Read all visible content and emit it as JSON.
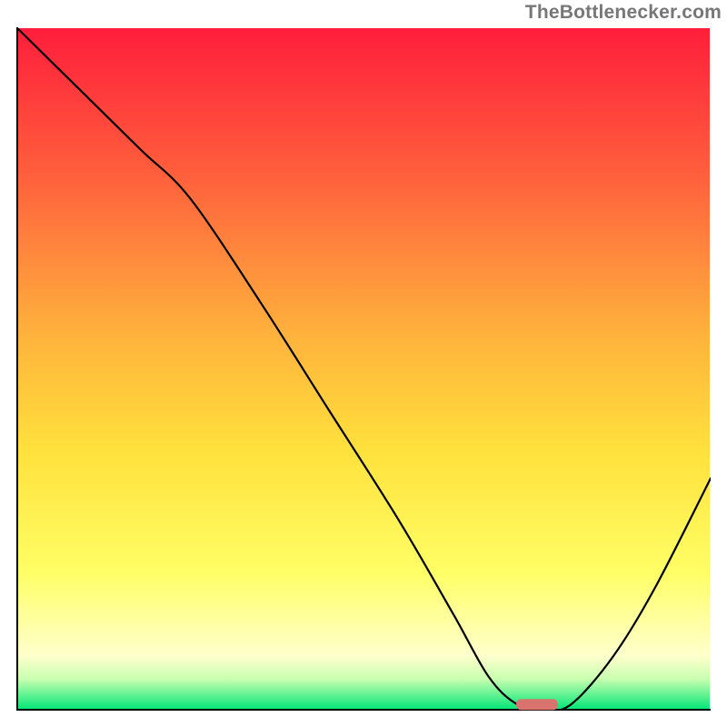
{
  "attribution": "TheBottlenecker.com",
  "chart_data": {
    "type": "line",
    "title": "",
    "xlabel": "",
    "ylabel": "",
    "xlim": [
      0,
      100
    ],
    "ylim": [
      0,
      100
    ],
    "gradient_stops": [
      {
        "offset": 0,
        "color": "#ff1e3c"
      },
      {
        "offset": 0.2,
        "color": "#ff5a3c"
      },
      {
        "offset": 0.45,
        "color": "#ffb23c"
      },
      {
        "offset": 0.62,
        "color": "#ffe13c"
      },
      {
        "offset": 0.8,
        "color": "#ffff66"
      },
      {
        "offset": 0.92,
        "color": "#ffffcc"
      },
      {
        "offset": 0.955,
        "color": "#c8ffb0"
      },
      {
        "offset": 1.0,
        "color": "#00e676"
      }
    ],
    "series": [
      {
        "name": "bottleneck-curve",
        "x": [
          0,
          10,
          18,
          25,
          35,
          45,
          55,
          63,
          68,
          72,
          76,
          80,
          86,
          92,
          100
        ],
        "y": [
          100,
          90,
          82,
          75,
          60,
          44,
          28,
          14,
          5,
          1,
          0,
          1,
          8,
          18,
          34
        ]
      }
    ],
    "marker": {
      "name": "optimal-marker",
      "x_center": 75,
      "y": 0.5,
      "width": 6,
      "color": "#d9736e"
    },
    "axes": {
      "show_ticks": false,
      "show_grid": false,
      "frame_color": "#000000",
      "frame_width": 2
    }
  }
}
